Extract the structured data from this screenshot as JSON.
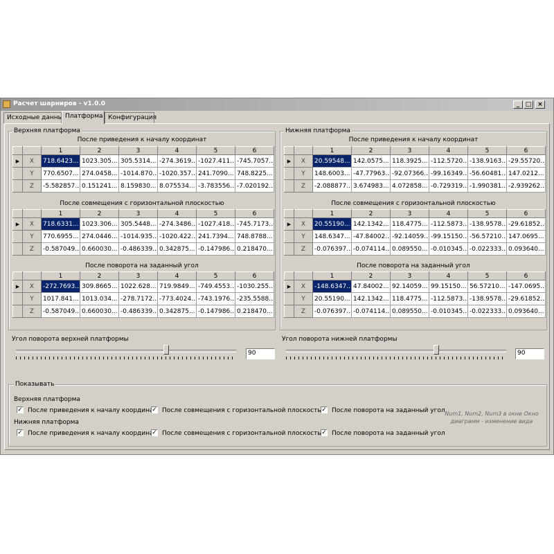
{
  "window": {
    "title": "Расчет шарниров - v1.0.0",
    "controls": {
      "minimize": "_",
      "maximize": "□",
      "close": "×"
    }
  },
  "tabs": [
    {
      "label": "Исходные данные",
      "active": false
    },
    {
      "label": "Платформа",
      "active": true
    },
    {
      "label": "Конфигурация",
      "active": false
    }
  ],
  "columns": [
    "1",
    "2",
    "3",
    "4",
    "5",
    "6"
  ],
  "upper": {
    "title": "Верхняя платформа",
    "captions": [
      "После приведения к началу координат",
      "После совмещения с горизонтальной плоскостью",
      "После поворота на заданный угол"
    ],
    "grids": [
      {
        "rows": [
          {
            "name": "X",
            "current": true,
            "cells": [
              "718.6423...",
              "1023.305...",
              "305.5314...",
              "-274.3619...",
              "-1027.411...",
              "-745.7057..."
            ]
          },
          {
            "name": "Y",
            "cells": [
              "770.6507...",
              "274.0458...",
              "-1014.870...",
              "-1020.357...",
              "241.7090...",
              "748.8225..."
            ]
          },
          {
            "name": "Z",
            "cells": [
              "-5.582857...",
              "0.151241...",
              "8.159830...",
              "8.075534...",
              "-3.783556...",
              "-7.020192..."
            ]
          }
        ]
      },
      {
        "rows": [
          {
            "name": "X",
            "current": true,
            "cells": [
              "718.6331...",
              "1023.306...",
              "305.5448...",
              "-274.3486...",
              "-1027.418...",
              "-745.7173..."
            ]
          },
          {
            "name": "Y",
            "cells": [
              "770.6955...",
              "274.0446...",
              "-1014.935...",
              "-1020.422...",
              "241.7394...",
              "748.8788..."
            ]
          },
          {
            "name": "Z",
            "cells": [
              "-0.587049...",
              "0.660030...",
              "-0.486339...",
              "0.342875...",
              "-0.147986...",
              "0.218470..."
            ]
          }
        ]
      },
      {
        "rows": [
          {
            "name": "X",
            "current": true,
            "cells": [
              "-272.7693...",
              "309.8665...",
              "1022.628...",
              "719.9849...",
              "-749.4553...",
              "-1030.255..."
            ]
          },
          {
            "name": "Y",
            "cells": [
              "1017.841...",
              "1013.034...",
              "-278.7172...",
              "-773.4024...",
              "-743.1976...",
              "-235.5588..."
            ]
          },
          {
            "name": "Z",
            "cells": [
              "-0.587049...",
              "0.660030...",
              "-0.486339...",
              "0.342875...",
              "-0.147986...",
              "0.218470..."
            ]
          }
        ]
      }
    ],
    "slider_label": "Угол поворота верхней платформы",
    "angle": "90",
    "slider_fraction": 0.5
  },
  "lower": {
    "title": "Нижняя платформа",
    "captions": [
      "После приведения к началу координат",
      "После совмещения с горизонтальной плоскостью",
      "После поворота на заданный угол"
    ],
    "grids": [
      {
        "rows": [
          {
            "name": "X",
            "current": true,
            "cells": [
              "20.59548...",
              "142.0575...",
              "118.3925...",
              "-112.5720...",
              "-138.9163...",
              "-29.55720..."
            ]
          },
          {
            "name": "Y",
            "cells": [
              "148.6003...",
              "-47.77963...",
              "-92.07366...",
              "-99.16349...",
              "-56.60481...",
              "147.0212..."
            ]
          },
          {
            "name": "Z",
            "cells": [
              "-2.088877...",
              "3.674983...",
              "4.072858...",
              "-0.729319...",
              "-1.990381...",
              "-2.939262..."
            ]
          }
        ]
      },
      {
        "rows": [
          {
            "name": "X",
            "current": true,
            "cells": [
              "20.55190...",
              "142.1342...",
              "118.4775...",
              "-112.5873...",
              "-138.9578...",
              "-29.61852..."
            ]
          },
          {
            "name": "Y",
            "cells": [
              "148.6347...",
              "-47.84002...",
              "-92.14059...",
              "-99.15150...",
              "-56.57210...",
              "147.0695..."
            ]
          },
          {
            "name": "Z",
            "cells": [
              "-0.076397...",
              "-0.074114...",
              "0.089550...",
              "-0.010345...",
              "-0.022333...",
              "0.093640..."
            ]
          }
        ]
      },
      {
        "rows": [
          {
            "name": "X",
            "current": true,
            "cells": [
              "-148.6347...",
              "47.84002...",
              "92.14059...",
              "99.15150...",
              "56.57210...",
              "-147.0695..."
            ]
          },
          {
            "name": "Y",
            "cells": [
              "20.55190...",
              "142.1342...",
              "118.4775...",
              "-112.5873...",
              "-138.9578...",
              "-29.61852..."
            ]
          },
          {
            "name": "Z",
            "cells": [
              "-0.076397...",
              "-0.074114...",
              "0.089550...",
              "-0.010345...",
              "-0.022333...",
              "0.093640..."
            ]
          }
        ]
      }
    ],
    "slider_label": "Угол поворота нижней платформы",
    "angle": "90",
    "slider_fraction": 0.5
  },
  "show": {
    "title": "Показывать",
    "upper_label": "Верхняя платформа",
    "lower_label": "Нижняя платформа",
    "opt1": "После приведения к началу координат",
    "opt2": "После совмещения с горизонтальной плоскостью",
    "opt3": "После поворота на заданный угол",
    "checked": true,
    "hint": "Num1, Num2, Num3 в окне Окно диаграмм - изменение вида"
  }
}
